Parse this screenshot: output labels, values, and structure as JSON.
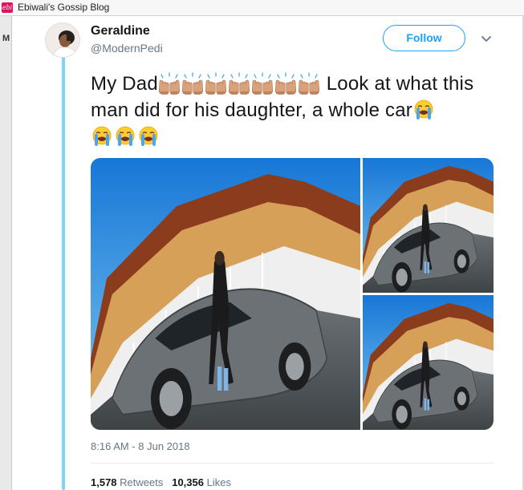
{
  "browser": {
    "favicon_text": "ebi",
    "title": "Ebiwali's Gossip Blog",
    "left_frame_letter": "M"
  },
  "tweet": {
    "display_name": "Geraldine",
    "handle": "@ModernPedi",
    "follow_label": "Follow",
    "text_line1_start": "My Dad",
    "text_line1_end": " Look at what this",
    "text_line2": "man did for his daughter, a whole car",
    "emojis": {
      "line1": [
        "raising-hands",
        "raising-hands",
        "raising-hands",
        "raising-hands",
        "raising-hands",
        "raising-hands",
        "raising-hands"
      ],
      "line2_end": [
        "loudly-crying-face"
      ],
      "line3": [
        "loudly-crying-face",
        "loudly-crying-face",
        "loudly-crying-face"
      ]
    },
    "timestamp": "8:16 AM - 8 Jun 2018",
    "retweets_count": "1,578",
    "retweets_label": "Retweets",
    "likes_count": "10,356",
    "likes_label": "Likes"
  },
  "colors": {
    "accent": "#1da1f2",
    "thread_line": "#7fd4f5",
    "secondary_text": "#657786",
    "primary_text": "#14171a"
  }
}
